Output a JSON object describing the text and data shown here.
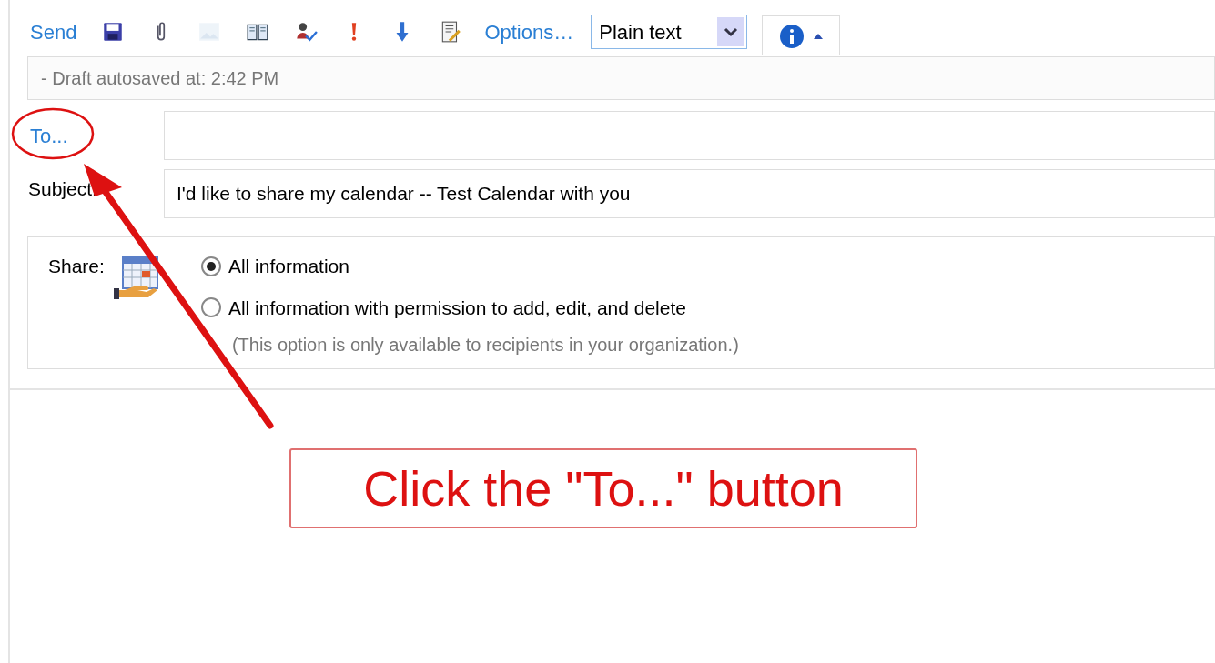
{
  "toolbar": {
    "send": "Send",
    "tools": [
      {
        "kind": "save",
        "disabled": false
      },
      {
        "kind": "attach",
        "disabled": false
      },
      {
        "kind": "image",
        "disabled": true
      },
      {
        "kind": "book",
        "disabled": false
      },
      {
        "kind": "check-names",
        "disabled": false
      },
      {
        "kind": "importance",
        "disabled": false
      },
      {
        "kind": "low",
        "disabled": false
      },
      {
        "kind": "signature",
        "disabled": false
      }
    ],
    "options": "Options…",
    "format": "Plain text"
  },
  "status": "- Draft autosaved at: 2:42 PM",
  "to": {
    "label": "To..."
  },
  "subject": {
    "label": "Subject:",
    "value": "I'd like to share my calendar -- Test Calendar with you"
  },
  "share": {
    "label": "Share:",
    "options": [
      {
        "label": "All information",
        "selected": true
      },
      {
        "label": "All information with permission to add, edit, and delete",
        "selected": false
      }
    ],
    "note": "(This option is only available to recipients in your organization.)"
  },
  "callout": "Click the \"To...\" button"
}
